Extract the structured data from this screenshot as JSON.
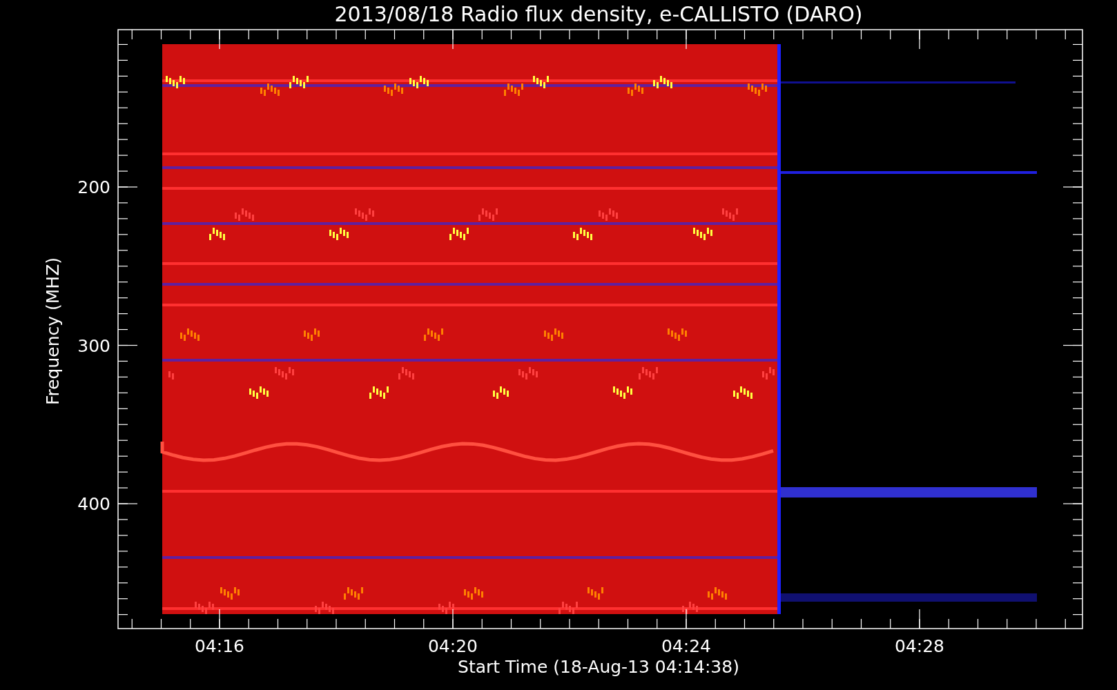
{
  "title": "2013/08/18  Radio flux density, e-CALLISTO (DARO)",
  "y_axis": {
    "label": "Frequency (MHZ)",
    "ticks": [
      "200",
      "300",
      "400"
    ]
  },
  "x_axis": {
    "label": "Start Time (18-Aug-13 04:14:38)",
    "ticks": [
      "04:16",
      "04:20",
      "04:24",
      "04:28"
    ]
  }
}
